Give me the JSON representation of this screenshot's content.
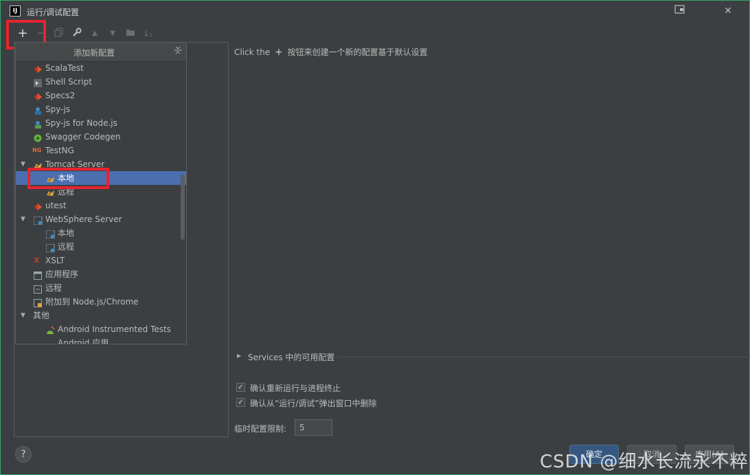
{
  "window": {
    "title": "运行/调试配置"
  },
  "popup": {
    "title": "添加新配置",
    "items": [
      {
        "label": "ScalaTest",
        "icon": "scala-icon"
      },
      {
        "label": "Shell Script",
        "icon": "shell-script-icon"
      },
      {
        "label": "Specs2",
        "icon": "scala-icon"
      },
      {
        "label": "Spy-js",
        "icon": "spy-js-icon"
      },
      {
        "label": "Spy-js for Node.js",
        "icon": "spy-js-node-icon"
      },
      {
        "label": "Swagger Codegen",
        "icon": "swagger-icon"
      },
      {
        "label": "TestNG",
        "icon": "testng-icon"
      },
      {
        "label": "Tomcat Server",
        "icon": "tomcat-icon"
      },
      {
        "label": "本地",
        "icon": "tomcat-icon"
      },
      {
        "label": "远程",
        "icon": "tomcat-icon"
      },
      {
        "label": "utest",
        "icon": "scala-icon"
      },
      {
        "label": "WebSphere Server",
        "icon": "websphere-icon"
      },
      {
        "label": "本地",
        "icon": "websphere-icon"
      },
      {
        "label": "远程",
        "icon": "websphere-icon"
      },
      {
        "label": "XSLT",
        "icon": "xslt-icon"
      },
      {
        "label": "应用程序",
        "icon": "application-icon"
      },
      {
        "label": "远程",
        "icon": "remote-icon"
      },
      {
        "label": "附加到 Node.js/Chrome",
        "icon": "attach-node-icon"
      },
      {
        "label": "其他",
        "icon": ""
      },
      {
        "label": "Android Instrumented Tests",
        "icon": "android-icon"
      },
      {
        "label": "Android 应用",
        "icon": "android-icon"
      }
    ]
  },
  "main": {
    "hint_prefix": "Click the",
    "hint_plus": "+",
    "hint_suffix": "按钮来创建一个新的配置基于默认设置",
    "services_label": "Services 中的可用配置",
    "check_confirm_rerun": "确认重新运行与进程终止",
    "check_confirm_delete": "确认从“运行/调试”弹出窗口中删除",
    "limit_label": "临时配置限制:",
    "limit_value": "5"
  },
  "buttons": {
    "ok": "确定",
    "cancel": "取消",
    "apply": "应用(A)"
  },
  "help": "?",
  "watermark": "CSDN @细水长流永不粹",
  "colors": {
    "background": "#3c3f41",
    "selection": "#4b6eaf",
    "highlight_box": "#e8232f",
    "primary_button": "#365880"
  }
}
